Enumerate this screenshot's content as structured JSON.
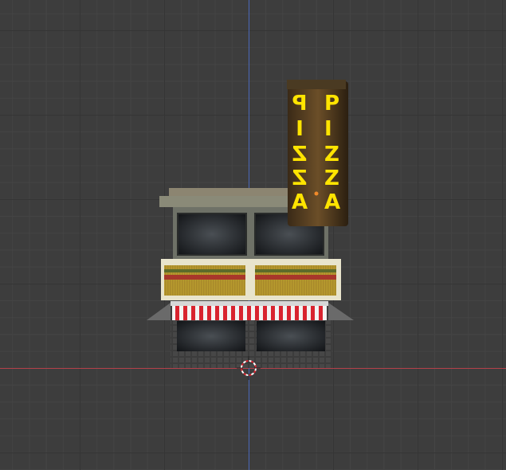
{
  "viewport": {
    "mode": "orthographic-front",
    "background_color": "#3d3d3d",
    "axis_x_color": "#b3404a",
    "axis_z_color": "#4a67b8"
  },
  "scene": {
    "object": "pizza-shop-building",
    "sign": {
      "color": "#ffe400",
      "column_a": [
        "P",
        "I",
        "Z",
        "Z",
        "A"
      ],
      "column_b": [
        "P",
        "I",
        "Z",
        "Z",
        "A"
      ]
    },
    "awning_colors": [
      "#d8232f",
      "#ffffff"
    ]
  },
  "icons": {
    "cursor": "3d-cursor-icon",
    "origin": "object-origin-icon"
  }
}
